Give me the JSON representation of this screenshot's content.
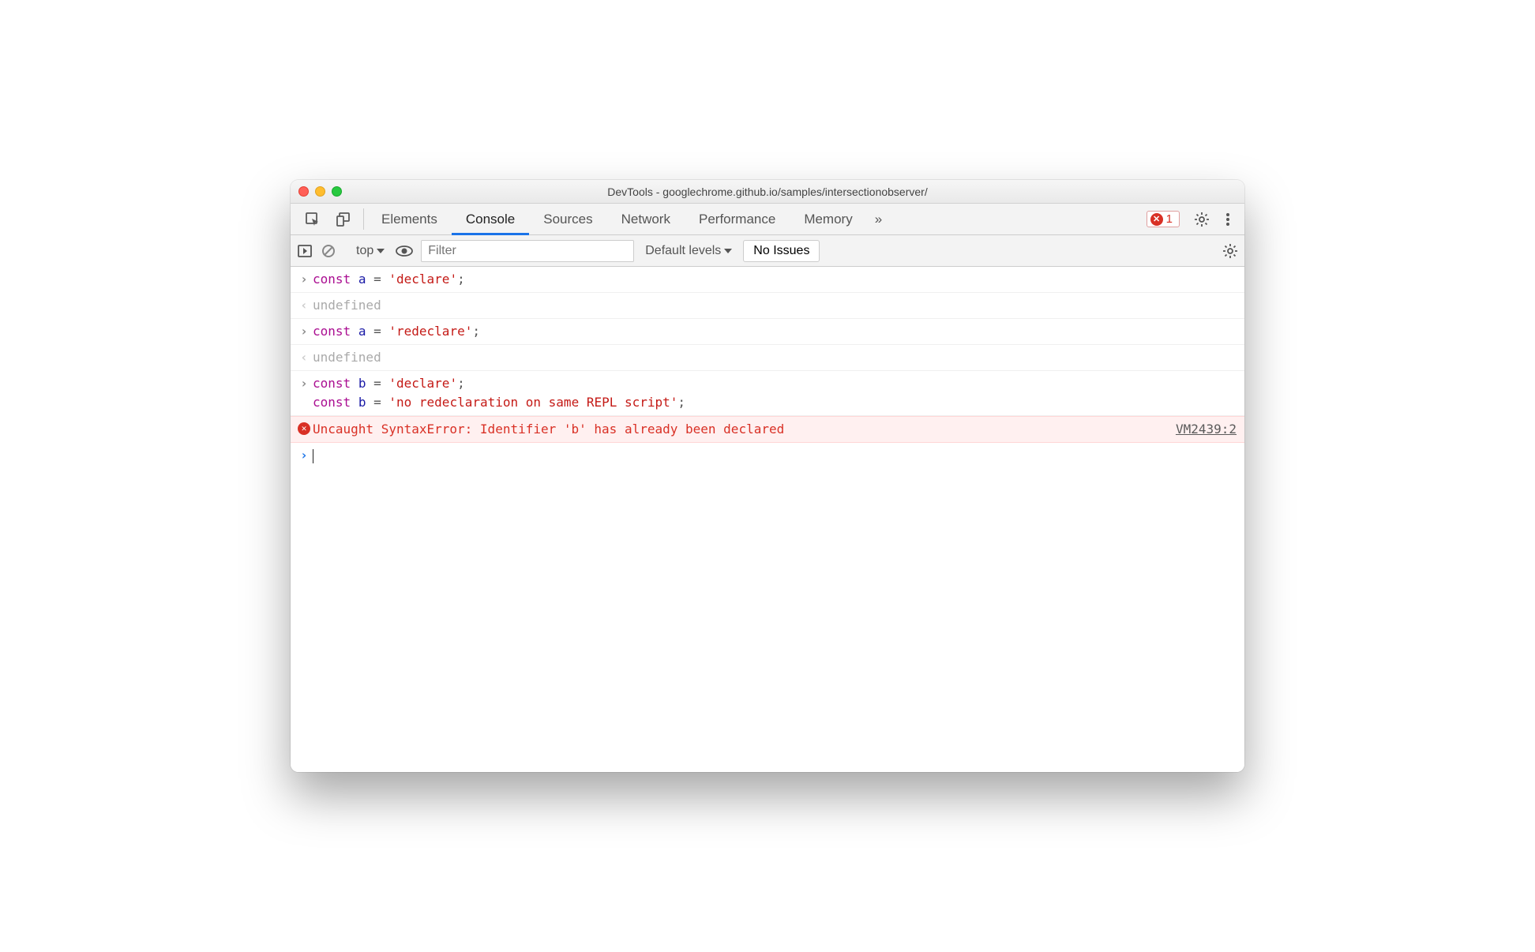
{
  "window": {
    "title": "DevTools - googlechrome.github.io/samples/intersectionobserver/"
  },
  "tabs": {
    "items": [
      "Elements",
      "Console",
      "Sources",
      "Network",
      "Performance",
      "Memory"
    ],
    "active_index": 1,
    "more_label": "»"
  },
  "errors": {
    "count": "1"
  },
  "filterbar": {
    "context": "top",
    "filter_placeholder": "Filter",
    "filter_value": "",
    "levels": "Default levels",
    "issues_label": "No Issues"
  },
  "console": {
    "entries": [
      {
        "kind": "input",
        "tokens": [
          {
            "t": "kw",
            "v": "const"
          },
          {
            "t": "sp",
            "v": " "
          },
          {
            "t": "var",
            "v": "a"
          },
          {
            "t": "sp",
            "v": " "
          },
          {
            "t": "op",
            "v": "="
          },
          {
            "t": "sp",
            "v": " "
          },
          {
            "t": "str",
            "v": "'declare'"
          },
          {
            "t": "op",
            "v": ";"
          }
        ]
      },
      {
        "kind": "output",
        "text": "undefined"
      },
      {
        "kind": "input",
        "tokens": [
          {
            "t": "kw",
            "v": "const"
          },
          {
            "t": "sp",
            "v": " "
          },
          {
            "t": "var",
            "v": "a"
          },
          {
            "t": "sp",
            "v": " "
          },
          {
            "t": "op",
            "v": "="
          },
          {
            "t": "sp",
            "v": " "
          },
          {
            "t": "str",
            "v": "'redeclare'"
          },
          {
            "t": "op",
            "v": ";"
          }
        ]
      },
      {
        "kind": "output",
        "text": "undefined"
      },
      {
        "kind": "input-multi",
        "lines": [
          [
            {
              "t": "kw",
              "v": "const"
            },
            {
              "t": "sp",
              "v": " "
            },
            {
              "t": "var",
              "v": "b"
            },
            {
              "t": "sp",
              "v": " "
            },
            {
              "t": "op",
              "v": "="
            },
            {
              "t": "sp",
              "v": " "
            },
            {
              "t": "str",
              "v": "'declare'"
            },
            {
              "t": "op",
              "v": ";"
            }
          ],
          [
            {
              "t": "kw",
              "v": "const"
            },
            {
              "t": "sp",
              "v": " "
            },
            {
              "t": "var",
              "v": "b"
            },
            {
              "t": "sp",
              "v": " "
            },
            {
              "t": "op",
              "v": "="
            },
            {
              "t": "sp",
              "v": " "
            },
            {
              "t": "str",
              "v": "'no redeclaration on same REPL script'"
            },
            {
              "t": "op",
              "v": ";"
            }
          ]
        ]
      },
      {
        "kind": "error",
        "text": "Uncaught SyntaxError: Identifier 'b' has already been declared",
        "source": "VM2439:2"
      },
      {
        "kind": "prompt"
      }
    ]
  },
  "colors": {
    "accent": "#1a73e8",
    "error": "#d93025"
  }
}
